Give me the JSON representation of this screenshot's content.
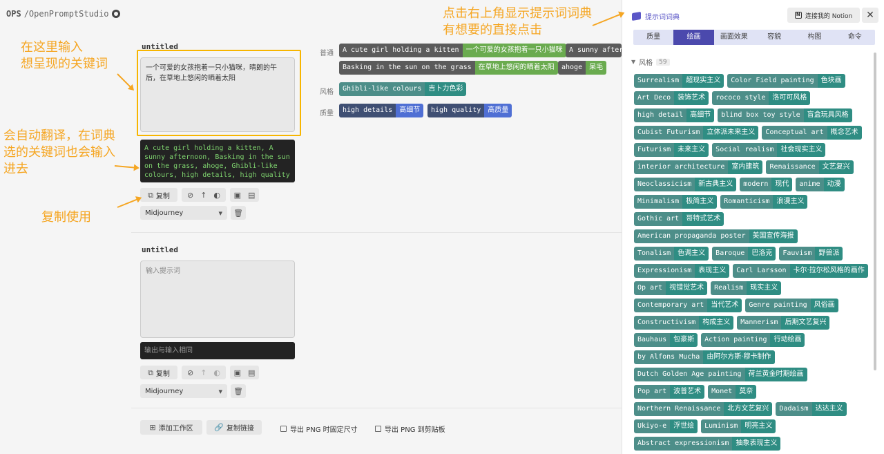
{
  "brand": {
    "text": "OPS",
    "slash_name": "/OpenPromptStudio"
  },
  "workspace1": {
    "title": "untitled",
    "input_value": "一个可爱的女孩抱着一只小猫咪，晴朗的午后，在草地上悠闲的晒着太阳",
    "output_value": "A cute girl holding a kitten, A sunny afternoon, Basking in the sun on the grass, ahoge, Ghibli-like colours, high details, high quality",
    "copy_label": "复制",
    "model": "Midjourney"
  },
  "workspace2": {
    "title": "untitled",
    "input_placeholder": "输入提示词",
    "output_placeholder": "输出与输入相同",
    "copy_label": "复制",
    "model": "Midjourney"
  },
  "tag_rows": {
    "general_label": "普通",
    "style_label": "风格",
    "quality_label": "质量",
    "general": [
      {
        "en": "A cute girl holding a kitten",
        "zh": "一个可爱的女孩抱着一只小猫咪"
      },
      {
        "en": "A sunny after",
        "zh": ""
      },
      {
        "en": "Basking in the sun on the grass",
        "zh": "在草地上悠闲的晒着太阳"
      },
      {
        "en": "ahoge",
        "zh": "呆毛"
      }
    ],
    "style": [
      {
        "en": "Ghibli-like colours",
        "zh": "吉卜力色彩"
      }
    ],
    "quality": [
      {
        "en": "high details",
        "zh": "高细节"
      },
      {
        "en": "high quality",
        "zh": "高质量"
      }
    ]
  },
  "footer": {
    "add_workspace": "添加工作区",
    "copy_link": "复制链接",
    "export_fixed": "导出 PNG 时固定尺寸",
    "export_clipboard": "导出 PNG 到剪贴板"
  },
  "dictionary": {
    "title": "提示词词典",
    "notion_button": "连接我的 Notion",
    "tabs": [
      "质量",
      "绘画",
      "画面效果",
      "容貌",
      "构图",
      "命令"
    ],
    "active_tab": "绘画",
    "section_name": "风格",
    "section_count": "59",
    "tags": [
      {
        "en": "Surrealism",
        "zh": "超现实主义"
      },
      {
        "en": "Color Field painting",
        "zh": "色块画"
      },
      {
        "en": "Art Deco",
        "zh": "装饰艺术"
      },
      {
        "en": "rococo style",
        "zh": "洛可可风格"
      },
      {
        "en": "high detail",
        "zh": "高细节"
      },
      {
        "en": "blind box toy style",
        "zh": "盲盒玩具风格"
      },
      {
        "en": "Cubist Futurism",
        "zh": "立体派未来主义"
      },
      {
        "en": "Conceptual art",
        "zh": "概念艺术"
      },
      {
        "en": "Futurism",
        "zh": "未来主义"
      },
      {
        "en": "Social realism",
        "zh": "社会现实主义"
      },
      {
        "en": "interior architecture",
        "zh": "室内建筑"
      },
      {
        "en": "Renaissance",
        "zh": "文艺复兴"
      },
      {
        "en": "Neoclassicism",
        "zh": "新古典主义"
      },
      {
        "en": "modern",
        "zh": "现代"
      },
      {
        "en": "anime",
        "zh": "动漫"
      },
      {
        "en": "Minimalism",
        "zh": "极简主义"
      },
      {
        "en": "Romanticism",
        "zh": "浪漫主义"
      },
      {
        "en": "Gothic art",
        "zh": "哥特式艺术"
      },
      {
        "en": "American propaganda poster",
        "zh": "美国宣传海报"
      },
      {
        "en": "Tonalism",
        "zh": "色调主义"
      },
      {
        "en": "Baroque",
        "zh": "巴洛克"
      },
      {
        "en": "Fauvism",
        "zh": "野兽派"
      },
      {
        "en": "Expressionism",
        "zh": "表现主义"
      },
      {
        "en": "Carl Larsson",
        "zh": "卡尔·拉尔松风格的画作"
      },
      {
        "en": "Op art",
        "zh": "视错觉艺术"
      },
      {
        "en": "Realism",
        "zh": "现实主义"
      },
      {
        "en": "Contemporary art",
        "zh": "当代艺术"
      },
      {
        "en": "Genre painting",
        "zh": "风俗画"
      },
      {
        "en": "Constructivism",
        "zh": "构成主义"
      },
      {
        "en": "Mannerism",
        "zh": "后期文艺复兴"
      },
      {
        "en": "Bauhaus",
        "zh": "包豪斯"
      },
      {
        "en": "Action painting",
        "zh": "行动绘画"
      },
      {
        "en": "by Alfons Mucha",
        "zh": "由阿尔方斯·穆卡制作"
      },
      {
        "en": "Dutch Golden Age painting",
        "zh": "荷兰黄金时期绘画"
      },
      {
        "en": "Pop art",
        "zh": "波普艺术"
      },
      {
        "en": "Monet",
        "zh": "莫奈"
      },
      {
        "en": "Northern Renaissance",
        "zh": "北方文艺复兴"
      },
      {
        "en": "Dadaism",
        "zh": "达达主义"
      },
      {
        "en": "Ukiyo-e",
        "zh": "浮世绘"
      },
      {
        "en": "Luminism",
        "zh": "明亮主义"
      },
      {
        "en": "Abstract expressionism",
        "zh": "抽象表现主义"
      }
    ]
  },
  "annotations": {
    "top_right_1": "点击右上角显示提示词词典",
    "top_right_2": "有想要的直接点击",
    "input_1": "在这里输入",
    "input_2": "想呈现的关键词",
    "translate_1": "会自动翻译，在词典",
    "translate_2": "选的关键词也会输入",
    "translate_3": "进去",
    "copy": "复制使用"
  },
  "colors": {
    "accent": "#4b49ad",
    "annotation": "#f5a623",
    "tag_teal": "#2f8d83"
  }
}
